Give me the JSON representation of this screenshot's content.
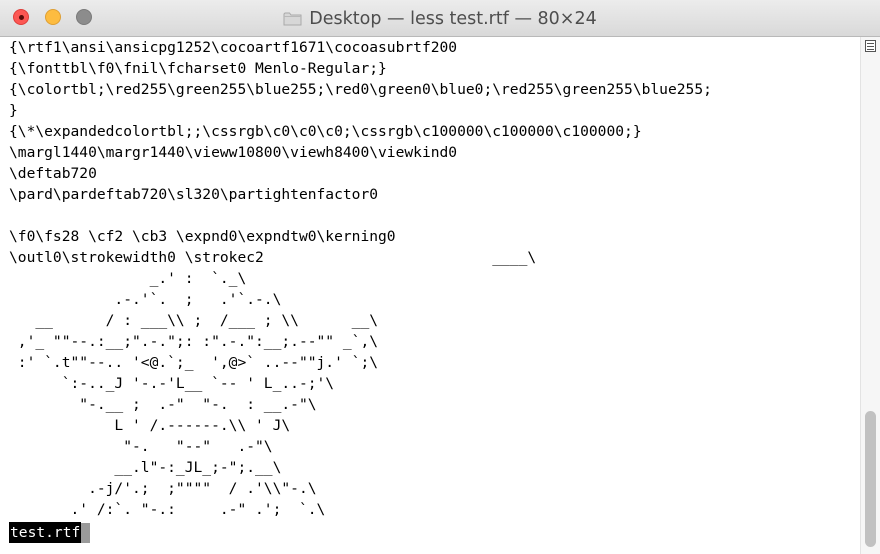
{
  "window": {
    "title": "Desktop — less test.rtf — 80×24",
    "colors": {
      "close": "#fc5753",
      "minimize": "#fdbc40",
      "maximize": "#8c8c8c"
    },
    "title_icon": "folder-icon"
  },
  "terminal": {
    "lines": [
      "{\\rtf1\\ansi\\ansicpg1252\\cocoartf1671\\cocoasubrtf200",
      "{\\fonttbl\\f0\\fnil\\fcharset0 Menlo-Regular;}",
      "{\\colortbl;\\red255\\green255\\blue255;\\red0\\green0\\blue0;\\red255\\green255\\blue255;",
      "}",
      "{\\*\\expandedcolortbl;;\\cssrgb\\c0\\c0\\c0;\\cssrgb\\c100000\\c100000\\c100000;}",
      "\\margl1440\\margr1440\\vieww10800\\viewh8400\\viewkind0",
      "\\deftab720",
      "\\pard\\pardeftab720\\sl320\\partightenfactor0",
      "",
      "\\f0\\fs28 \\cf2 \\cb3 \\expnd0\\expndtw0\\kerning0",
      "\\outl0\\strokewidth0 \\strokec2                          ____\\",
      "                _.' :  `._\\",
      "            .-.'`.  ;   .'`.-.\\",
      "   __      / : ___\\\\ ;  /___ ; \\\\      __\\",
      " ,'_ \"\"--.:__;\".-.\";: :\".-.\":__;.--\"\" _`,\\",
      " :' `.t\"\"--.. '<@.`;_  ',@>` ..--\"\"j.' `;\\",
      "      `:-.._J '-.-'L__ `-- ' L_..-;'\\",
      "        \"-.__ ;  .-\"  \"-.  : __.-\"\\",
      "            L ' /.------.\\\\ ' J\\",
      "             \"-.   \"--\"   .-\"\\",
      "            __.l\"-:_JL_;-\";.__\\",
      "         .-j/'.;  ;\"\"\"\"  / .'\\\\\"-.\\",
      "       .' /:`. \"-.:     .-\" .';  `.\\"
    ],
    "status": "test.rtf"
  },
  "scrollbar": {
    "position": 0.73,
    "icon": "scroll-menu-icon"
  }
}
